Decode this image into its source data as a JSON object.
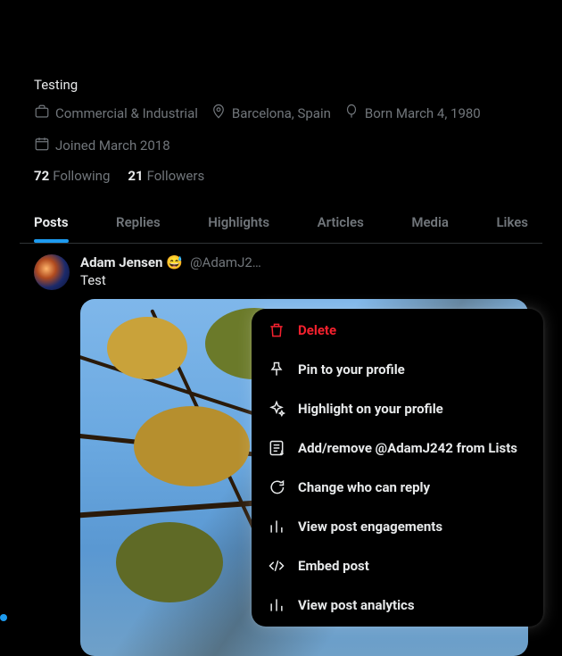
{
  "profile": {
    "bio": "Testing",
    "category": "Commercial & Industrial",
    "location": "Barcelona, Spain",
    "born": "Born March 4, 1980",
    "joined": "Joined March 2018",
    "following_count": "72",
    "following_label": "Following",
    "followers_count": "21",
    "followers_label": "Followers"
  },
  "tabs": {
    "posts": "Posts",
    "replies": "Replies",
    "highlights": "Highlights",
    "articles": "Articles",
    "media": "Media",
    "likes": "Likes"
  },
  "post": {
    "name": "Adam Jensen",
    "emoji": "😅",
    "handle": "@AdamJ2…",
    "text": "Test"
  },
  "menu": {
    "delete": "Delete",
    "pin": "Pin to your profile",
    "highlight": "Highlight on your profile",
    "lists": "Add/remove @AdamJ242 from Lists",
    "reply": "Change who can reply",
    "engagements": "View post engagements",
    "embed": "Embed post",
    "analytics": "View post analytics"
  }
}
